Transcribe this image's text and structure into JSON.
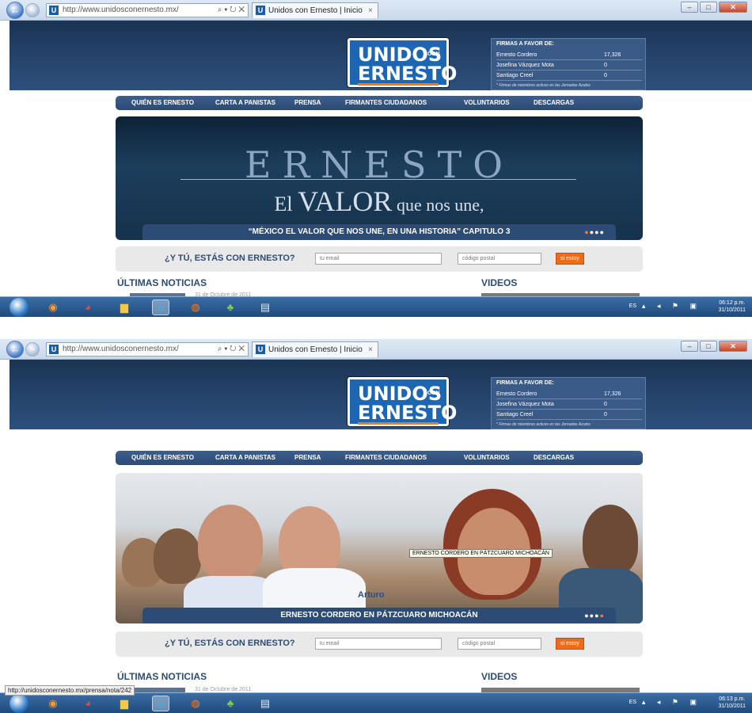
{
  "browser": {
    "address": "http://www.unidosconernesto.mx/",
    "address_tools": "⌕ ▾ ↻ ✕",
    "favicon_letter": "U",
    "tab_title": "Unidos con Ernesto | Inicio",
    "tab_close": "×",
    "win_min": "–",
    "win_max": "□",
    "win_close": "✕",
    "toolbar_icons": "⌂ ☆ ⚙"
  },
  "logo": {
    "line1": "UNIDOS",
    "con": "CON",
    "line2": "ERNESTO",
    "accent_color": "#f07a1f",
    "bg_color": "#1c66b4"
  },
  "firmas": {
    "title": "FIRMAS A FAVOR DE:",
    "rows": [
      {
        "name": "Ernesto Cordero",
        "count": "17,326"
      },
      {
        "name": "Josefina Vázquez Mota",
        "count": "0"
      },
      {
        "name": "Santiago Creel",
        "count": "0"
      }
    ],
    "note": "* Firmas de miembros activos en las Jornadas Azules"
  },
  "menu": {
    "items": [
      "QUIÉN ES ERNESTO",
      "CARTA A PANISTAS",
      "PRENSA",
      "FIRMANTES CIUDADANOS",
      "VOLUNTARIOS",
      "DESCARGAS"
    ]
  },
  "slide1": {
    "headline": "ERNESTO",
    "tagline_el": "El ",
    "tagline_valor": "VALOR",
    "tagline_rest": " que nos une,",
    "caption": "“MÉXICO EL VALOR QUE NOS UNE, EN UNA HISTORIA” CAPITULO 3",
    "dots_on": "●",
    "dots_off": "●●●"
  },
  "slide2": {
    "tooltip": "ERNESTO CORDERO EN PÁTZCUARO MICHOACÁN",
    "shirt_text": "Arturo",
    "caption": "ERNESTO CORDERO EN PÁTZCUARO MICHOACÁN",
    "dots_off": "●●●",
    "dots_on": "●"
  },
  "signup": {
    "question": "¿Y TÚ, ESTÁS CON ERNESTO?",
    "email_placeholder": "tu email",
    "zip_placeholder": "código postal",
    "button": "si estoy"
  },
  "sections": {
    "news": "ÚLTIMAS NOTICIAS",
    "videos": "VIDEOS",
    "news_date": "31 de Octubre de 2011"
  },
  "status_bar": {
    "url": "http://unidosconernesto.mx/prensa/nota/242"
  },
  "taskbar": {
    "lang": "ES",
    "tray_icons": "▴ ◂ ⚑ ▣",
    "time1": "06:12 p.m.",
    "time2": "06:13 p.m.",
    "date": "31/10/2011"
  },
  "colors": {
    "header_bg": "#26466f",
    "menu_bg": "#2c4b75",
    "button_orange": "#f06a17"
  }
}
